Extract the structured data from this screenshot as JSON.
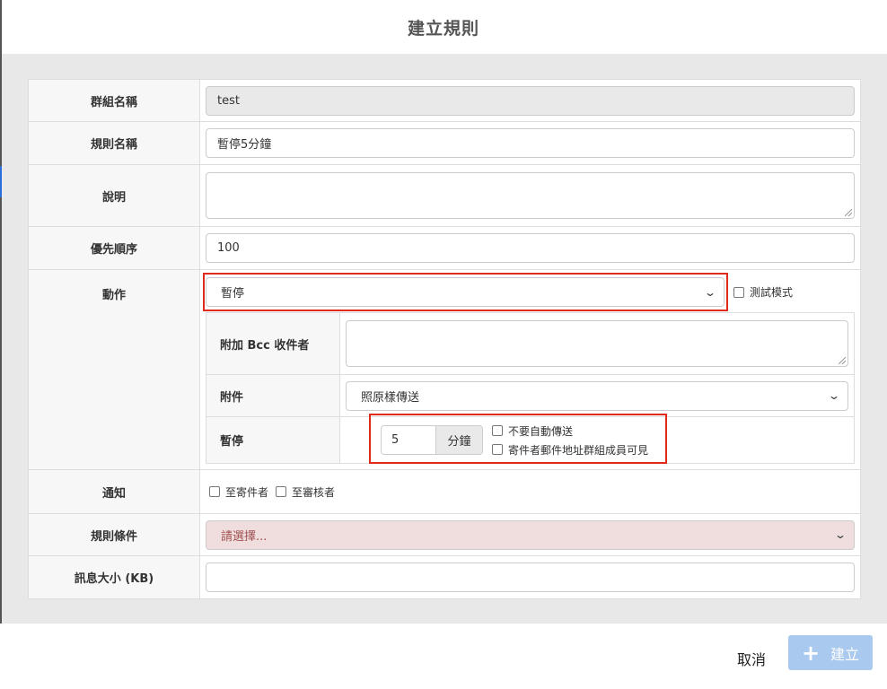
{
  "modal": {
    "title": "建立規則"
  },
  "form": {
    "group_name": {
      "label": "群組名稱",
      "value": "test"
    },
    "rule_name": {
      "label": "規則名稱",
      "value": "暫停5分鐘"
    },
    "description": {
      "label": "說明",
      "value": ""
    },
    "priority": {
      "label": "優先順序",
      "value": "100"
    },
    "action": {
      "label": "動作",
      "selected": "暫停",
      "test_mode_label": "測試模式",
      "bcc": {
        "label": "附加 Bcc 收件者",
        "value": ""
      },
      "attachment": {
        "label": "附件",
        "selected": "照原樣傳送"
      },
      "pause": {
        "label": "暫停",
        "value": "5",
        "unit": "分鐘",
        "no_auto_send_label": "不要自動傳送",
        "visible_to_members_label": "寄件者郵件地址群組成員可見"
      }
    },
    "notify": {
      "label": "通知",
      "to_sender": "至寄件者",
      "to_reviewer": "至審核者"
    },
    "conditions": {
      "label": "規則條件",
      "placeholder": "請選擇..."
    },
    "size": {
      "label": "訊息大小 (KB)",
      "value": ""
    }
  },
  "footer": {
    "cancel_label": "取消",
    "create_label": "建立"
  },
  "colors": {
    "highlight": "#e02a1b",
    "primary_disabled": "#a9c9ee",
    "error_bg": "#f0dede"
  }
}
